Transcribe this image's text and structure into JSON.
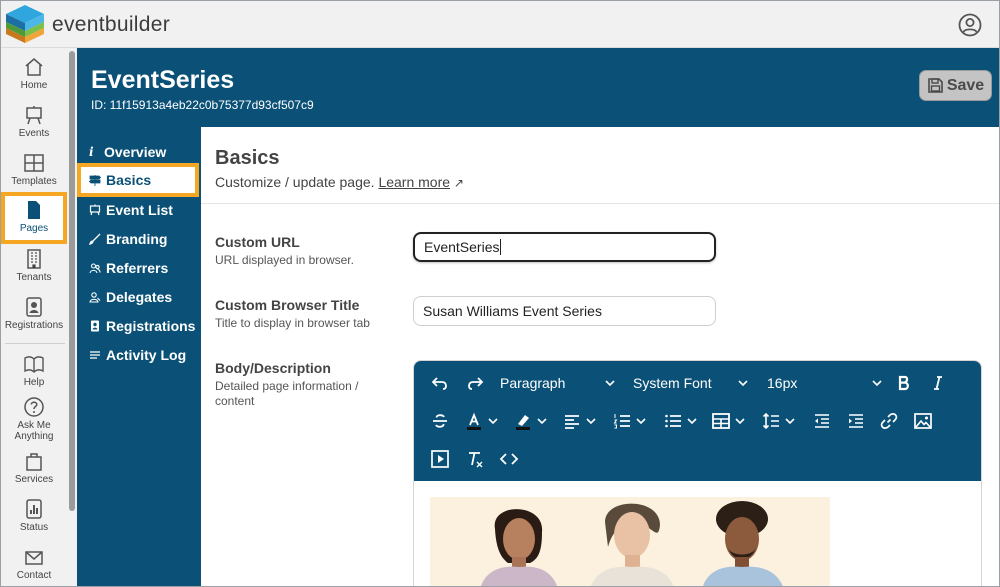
{
  "app": {
    "brand": "eventbuilder",
    "brand_colors": {
      "primary": "#0b5177",
      "highlight": "#f5a623"
    }
  },
  "rail": {
    "items": [
      {
        "label": "Home",
        "icon": "home-icon"
      },
      {
        "label": "Events",
        "icon": "easel-icon"
      },
      {
        "label": "Templates",
        "icon": "templates-icon"
      },
      {
        "label": "Pages",
        "icon": "page-icon"
      },
      {
        "label": "Tenants",
        "icon": "building-icon"
      },
      {
        "label": "Registrations",
        "icon": "id-card-icon"
      },
      {
        "label": "Help",
        "icon": "book-icon"
      },
      {
        "label": "Ask Me Anything",
        "icon": "question-icon"
      },
      {
        "label": "Services",
        "icon": "bag-icon"
      },
      {
        "label": "Status",
        "icon": "bar-chart-icon"
      },
      {
        "label": "Contact",
        "icon": "mail-icon"
      }
    ],
    "active": "Pages"
  },
  "header": {
    "title": "EventSeries",
    "id_text": "ID: 11f15913a4eb22c0b75377d93cf507c9",
    "save_label": "Save"
  },
  "subnav": {
    "items": [
      {
        "label": "Overview",
        "icon": "info-icon"
      },
      {
        "label": "Basics",
        "icon": "signpost-icon"
      },
      {
        "label": "Event List",
        "icon": "easel-icon"
      },
      {
        "label": "Branding",
        "icon": "brush-icon"
      },
      {
        "label": "Referrers",
        "icon": "users-icon"
      },
      {
        "label": "Delegates",
        "icon": "delegate-icon"
      },
      {
        "label": "Registrations",
        "icon": "id-card-icon"
      },
      {
        "label": "Activity Log",
        "icon": "list-icon"
      }
    ],
    "active": "Basics"
  },
  "main": {
    "section_title": "Basics",
    "section_subtitle": "Customize / update page.",
    "learn_more": "Learn more",
    "fields": {
      "custom_url": {
        "label": "Custom URL",
        "help": "URL displayed in browser.",
        "value": "EventSeries"
      },
      "browser_title": {
        "label": "Custom Browser Title",
        "help": "Title to display in browser tab",
        "value": "Susan Williams Event Series"
      },
      "body": {
        "label": "Body/Description",
        "help": "Detailed page information / content"
      }
    },
    "editor": {
      "block_format": "Paragraph",
      "font_family": "System Font",
      "font_size": "16px"
    }
  }
}
